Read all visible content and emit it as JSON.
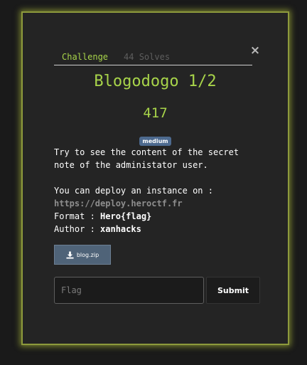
{
  "modal": {
    "tabs": [
      {
        "label": "Challenge",
        "active": true
      },
      {
        "label": "44 Solves",
        "active": false
      }
    ],
    "close_glyph": "×",
    "title": "Blogodogo 1/2",
    "points": "417",
    "difficulty": "medium",
    "description": {
      "line1": "Try to see the content of the secret",
      "line2": "note of the administator user.",
      "line3": "You can deploy an instance on :",
      "link": "https://deploy.heroctf.fr",
      "format_label": "Format : ",
      "format_value": "Hero{flag}",
      "author_label": "Author : ",
      "author_value": "xanhacks"
    },
    "file": {
      "label": "blog.zip",
      "icon": "download-icon"
    },
    "flag_placeholder": "Flag",
    "submit_label": "Submit"
  },
  "colors": {
    "accent": "#a8d44a",
    "modal_border_glow": "#c4d640",
    "badge": "#4d6a8f",
    "file_button": "#4f6378"
  }
}
